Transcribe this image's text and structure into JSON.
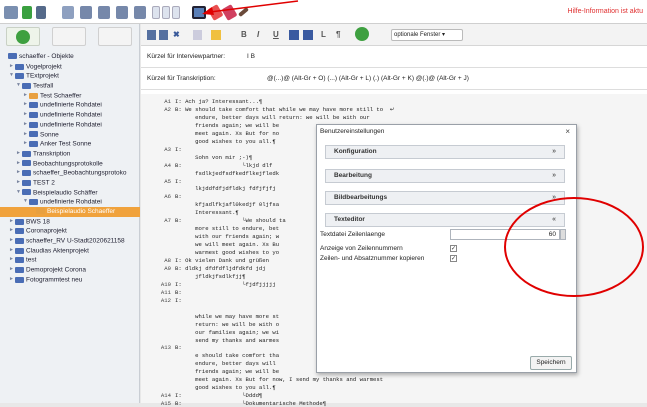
{
  "topbar": {
    "hint": "Hilfe-Information ist aktu"
  },
  "sidebar": {
    "tree": [
      {
        "label": "schaeffer - Objekte",
        "indent": 0,
        "icon": "#4a6db5",
        "tw": ""
      },
      {
        "label": "Vogelprojekt",
        "indent": 1,
        "icon": "#4a6db5",
        "tw": "►"
      },
      {
        "label": "TExtprojekt",
        "indent": 1,
        "icon": "#4a6db5",
        "tw": "▼"
      },
      {
        "label": "Testfall",
        "indent": 2,
        "icon": "#4a6db5",
        "tw": "▼"
      },
      {
        "label": "Test Schaeffer",
        "indent": 3,
        "icon": "#e8a040",
        "tw": "►"
      },
      {
        "label": "undefinierte Rohdatei",
        "indent": 3,
        "icon": "#4a6db5",
        "tw": "►"
      },
      {
        "label": "undefinierte Rohdatei",
        "indent": 3,
        "icon": "#4a6db5",
        "tw": "►"
      },
      {
        "label": "undefinierte Rohdatei",
        "indent": 3,
        "icon": "#4a6db5",
        "tw": "►"
      },
      {
        "label": "Sonne",
        "indent": 3,
        "icon": "#4a6db5",
        "tw": "►"
      },
      {
        "label": "Anker Test Sonne",
        "indent": 3,
        "icon": "#4a6db5",
        "tw": "►"
      },
      {
        "label": "Transkription",
        "indent": 2,
        "icon": "#4a6db5",
        "tw": "►"
      },
      {
        "label": "Beobachtungsprotokolle",
        "indent": 2,
        "icon": "#4a6db5",
        "tw": "►"
      },
      {
        "label": "schaeffer_Beobachtungsprotoko",
        "indent": 2,
        "icon": "#4a6db5",
        "tw": "►"
      },
      {
        "label": "TEST 2",
        "indent": 2,
        "icon": "#4a6db5",
        "tw": "►"
      },
      {
        "label": "Beispielaudio Schäffer",
        "indent": 2,
        "icon": "#4a6db5",
        "tw": "▼"
      },
      {
        "label": "undefinierte Rohdatei",
        "indent": 3,
        "icon": "#4a6db5",
        "tw": "▼"
      },
      {
        "label": "Beispielaudio Schaeffer",
        "indent": 4,
        "icon": "#e8a040",
        "tw": "",
        "sel": true
      },
      {
        "label": "BWS 18",
        "indent": 1,
        "icon": "#4a6db5",
        "tw": "►"
      },
      {
        "label": "Coronaprojekt",
        "indent": 1,
        "icon": "#4a6db5",
        "tw": "►"
      },
      {
        "label": "schaeffer_RV U-Stadt2020621158",
        "indent": 1,
        "icon": "#4a6db5",
        "tw": "►"
      },
      {
        "label": "Claudias Aktenprojekt",
        "indent": 1,
        "icon": "#4a6db5",
        "tw": "►"
      },
      {
        "label": "test",
        "indent": 1,
        "icon": "#4a6db5",
        "tw": "►"
      },
      {
        "label": "Demoprojekt Corona",
        "indent": 1,
        "icon": "#4a6db5",
        "tw": "►"
      },
      {
        "label": "Fotogrammtest neu",
        "indent": 1,
        "icon": "#4a6db5",
        "tw": "►"
      }
    ]
  },
  "toolbar": {
    "bold": "B",
    "italic": "I",
    "underline": "U",
    "l": "L",
    "para": "¶",
    "optional": "optionale Fenster"
  },
  "fields": {
    "interview_label": "Kürzel für Interviewpartner:",
    "interview_value": "I   B",
    "transcription_label": "Kürzel für Transkription:",
    "transcription_value": "@(...)@ (Alt-Gr + O)   (...) (Alt-Gr + L)   (.) (Alt-Gr + K)   @(.)@ (Alt-Gr + J)"
  },
  "editor": {
    "lines": [
      [
        "A1",
        "I: Ach ja? Interessant...¶"
      ],
      [
        "A2",
        "B: We should take comfort that while we may have more still to  ↵"
      ],
      [
        "",
        "      endure, better days will return: we will be with our"
      ],
      [
        "",
        "      friends again; we will be"
      ],
      [
        "",
        "      meet again. Xs But for no"
      ],
      [
        "",
        "      good wishes to you all.¶"
      ],
      [
        "A3",
        "I:"
      ],
      [
        "",
        "      Sohn von mir ;-)¶"
      ],
      [
        "A4",
        "B:                  └lkjd dlf"
      ],
      [
        "",
        "      fsdlkjedfsdfkedflkejfledk"
      ],
      [
        "A5",
        "I:"
      ],
      [
        "",
        "      lkjddfdfjdfldkj fdfjfjfj"
      ],
      [
        "A6",
        "B:"
      ],
      [
        "",
        "      kfjadlfkjafl0kedjf 0ljfsa"
      ],
      [
        "",
        "      Interessant.¶"
      ],
      [
        "A7",
        "B:                  └We should ta"
      ],
      [
        "",
        "      more still to endure, bet"
      ],
      [
        "",
        "      with our friends again; w"
      ],
      [
        "",
        "      we will meet again. Xs Bu"
      ],
      [
        "",
        "      warmest good wishes to yo"
      ],
      [
        "A8",
        "I: Ok vielen Dank und grüßen"
      ],
      [
        "A9",
        "B: dldkj dfdfdfljdfdkfd jdj"
      ],
      [
        "",
        "      jfldkjfsdlkfjj¶"
      ],
      [
        "A10",
        "I:                  └fjdfjjjjj"
      ],
      [
        "A11",
        "B:"
      ],
      [
        "A12",
        "I:"
      ],
      [
        "",
        ""
      ],
      [
        "",
        "      while we may have more st"
      ],
      [
        "",
        "      return: we will be with o"
      ],
      [
        "",
        "      our families again; we wi"
      ],
      [
        "",
        "      send my thanks and warmes"
      ],
      [
        "A13",
        "B:"
      ],
      [
        "",
        "      e should take comfort tha"
      ],
      [
        "",
        "      endure, better days will"
      ],
      [
        "",
        "      friends again; we will be"
      ],
      [
        "",
        "      meet again. Xs But for now, I send my thanks and warmest"
      ],
      [
        "",
        "      good wishes to you all.¶"
      ],
      [
        "A14",
        "I:                  └Dddd¶"
      ],
      [
        "A15",
        "B:                  └Dokumentarische Methode¶"
      ]
    ]
  },
  "dialog": {
    "title": "Benutzereinstellungen",
    "close": "×",
    "sections": [
      {
        "label": "Konfiguration",
        "chev": "»"
      },
      {
        "label": "Bearbeitung",
        "chev": "»"
      },
      {
        "label": "Bildbearbeitungs",
        "chev": "»"
      },
      {
        "label": "Texteditor",
        "chev": "«"
      }
    ],
    "line_length_label": "Textdatei Zeilenlaenge",
    "line_length_value": "60",
    "show_numbers_label": "Anzeige von Zeilennummern",
    "show_numbers_check": "✓",
    "copy_numbers_label": "Zeilen- und Absatznummer kopieren",
    "copy_numbers_check": "✓",
    "save": "Speichern"
  }
}
